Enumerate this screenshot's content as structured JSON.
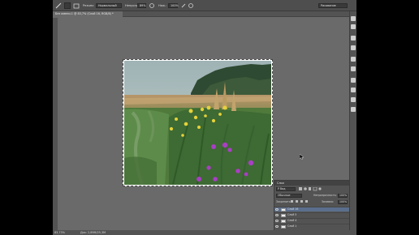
{
  "options_bar": {
    "tool_label": "Режим:",
    "mode_value": "Нормальный",
    "opacity_label": "Непрозр.:",
    "opacity_value": "89%",
    "flow_label": "Наж.:",
    "flow_value": "100%",
    "workspace_value": "Рисование"
  },
  "document_tab": {
    "title": "Без имени-1 @ 83,7% (Слой 16, RGB/8) *"
  },
  "status_bar": {
    "zoom": "83,73%",
    "doc_info": "Док: 2,89M/25,3M"
  },
  "layers_panel": {
    "title": "Слои",
    "filter_label": "Р Вид",
    "blend_mode": "Обычные",
    "opacity_label": "Непрозрачность:",
    "opacity_value": "100%",
    "lock_label": "Закрепить:",
    "fill_label": "Заливка:",
    "fill_value": "100%",
    "layers": [
      {
        "name": "Слой 16",
        "selected": true
      },
      {
        "name": "Слой 5",
        "selected": false
      },
      {
        "name": "Слой 4",
        "selected": false
      },
      {
        "name": "Слой 1",
        "selected": false
      }
    ]
  },
  "colors": {
    "app_bg": "#6a6a6a",
    "panel_bg": "#535353",
    "selected_layer": "#5b6f8d"
  }
}
